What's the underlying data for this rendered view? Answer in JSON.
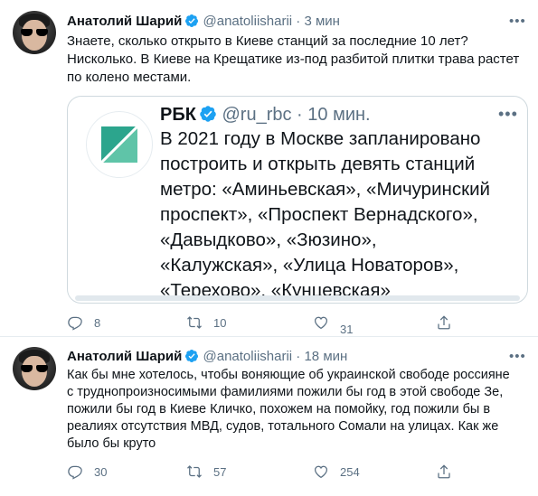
{
  "tweets": [
    {
      "author": "Анатолий Шарий",
      "handle": "@anatoliisharii",
      "separator": "·",
      "time": "3 мин",
      "more": "•••",
      "text_lines": [
        "Знаете, сколько открыто в Киеве станций за последние 10 лет?",
        "Нисколько. В Киеве на Крещатике из-под разбитой плитки трава растет",
        "по колено местами."
      ],
      "quote": {
        "author": "РБК",
        "handle": "@ru_rbc",
        "separator": "·",
        "time": "10 мин.",
        "more": "•••",
        "text_lines": [
          "В 2021 году в Москве запланировано",
          "построить и открыть девять станций",
          "метро: «Аминьевская», «Мичуринский",
          "проспект», «Проспект Вернадского»,",
          "«Давыдково», «Зюзино»,",
          "«Калужская», «Улица Новаторов»,",
          "«Терехово», «Кунцевская»"
        ]
      },
      "actions": {
        "replies": "8",
        "retweets": "10",
        "likes": "31"
      }
    },
    {
      "author": "Анатолий Шарий",
      "handle": "@anatoliisharii",
      "separator": "·",
      "time": "18 мин",
      "more": "•••",
      "text_lines": [
        "Как бы мне хотелось, чтобы воняющие об украинской свободе россияне",
        "с трудно­произносимыми фамилиями пожили бы год в этой свободе Зе,",
        "пожили бы год в Киеве Кличко, похожем на помойку, год пожили бы в",
        "реалиях отсутствия МВД, судов, тотального Сомали на улицах. Как же",
        "было бы круто"
      ],
      "actions": {
        "replies": "30",
        "retweets": "57",
        "likes": "254"
      }
    }
  ],
  "colors": {
    "accent": "#1da1f2",
    "muted": "#5b7083",
    "border": "#cfd9de"
  },
  "icons": [
    "reply-icon",
    "retweet-icon",
    "like-icon",
    "share-icon",
    "verified-icon",
    "more-icon"
  ]
}
